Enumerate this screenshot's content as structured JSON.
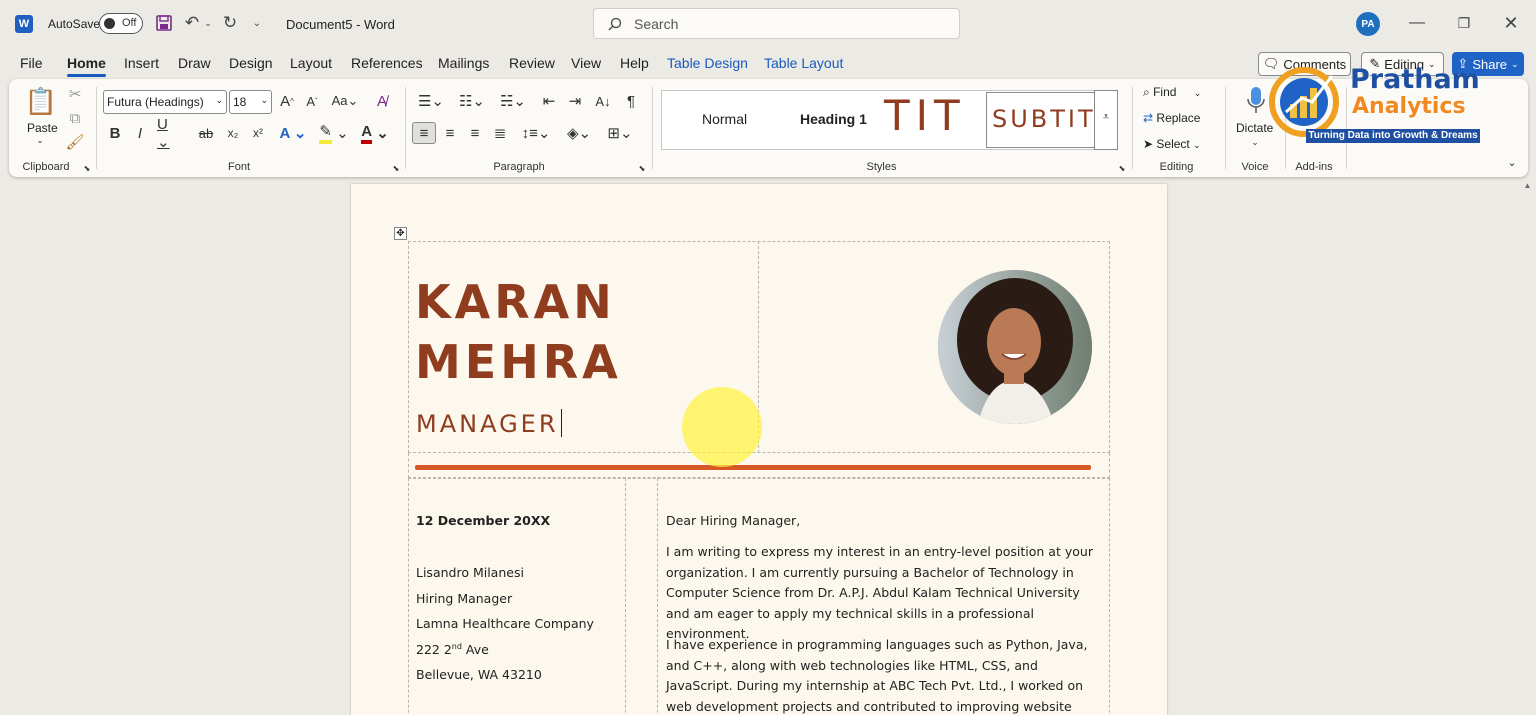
{
  "titlebar": {
    "autosave_label": "AutoSave",
    "autosave_state": "Off",
    "document_title": "Document5  -  Word",
    "search_placeholder": "Search",
    "user_initials": "PA"
  },
  "tabs": [
    "File",
    "Home",
    "Insert",
    "Draw",
    "Design",
    "Layout",
    "References",
    "Mailings",
    "Review",
    "View",
    "Help",
    "Table Design",
    "Table Layout"
  ],
  "active_tab": "Home",
  "tab_buttons": {
    "comments": "Comments",
    "editing": "Editing",
    "share": "Share"
  },
  "ribbon": {
    "clipboard": {
      "label": "Clipboard",
      "paste": "Paste"
    },
    "font": {
      "label": "Font",
      "font_name": "Futura (Headings)",
      "font_size": "18"
    },
    "paragraph": {
      "label": "Paragraph"
    },
    "styles": {
      "label": "Styles",
      "items": [
        "Normal",
        "Heading 1",
        "TIT",
        "SUBTIT"
      ]
    },
    "editing": {
      "label": "Editing",
      "find": "Find",
      "replace": "Replace",
      "select": "Select"
    },
    "voice": {
      "label": "Voice",
      "dictate": "Dictate"
    },
    "addins": {
      "label": "Add-ins"
    }
  },
  "watermark": {
    "brand_line1": "Pratham",
    "brand_line2": "Analytics",
    "tagline": "Turning Data into Growth & Dreams"
  },
  "document": {
    "first_name": "KARAN",
    "last_name": "MEHRA",
    "role": "MANAGER",
    "date": "12 December 20XX",
    "recipient": {
      "name": "Lisandro Milanesi",
      "title": "Hiring Manager",
      "company": "Lamna Healthcare Company",
      "address_num": "222 2",
      "address_sup": "nd",
      "address_rest": " Ave",
      "city": "Bellevue, WA 43210"
    },
    "greeting": "Dear Hiring Manager,",
    "paragraph1": "I am writing to express my interest in an entry-level position at your organization. I am currently pursuing a Bachelor of Technology in Computer Science from Dr. A.P.J. Abdul Kalam Technical University and am eager to apply my technical skills in a professional environment.",
    "paragraph2": "I have experience in programming languages such as Python, Java, and C++, along with web technologies like HTML, CSS, and JavaScript. During my internship at ABC Tech Pvt. Ltd., I worked on web development projects and contributed to improving website performance and user"
  },
  "colors": {
    "accent": "#8f3d1e",
    "rule": "#d55a27",
    "word_blue": "#185abd",
    "highlight": "#fff23a"
  }
}
